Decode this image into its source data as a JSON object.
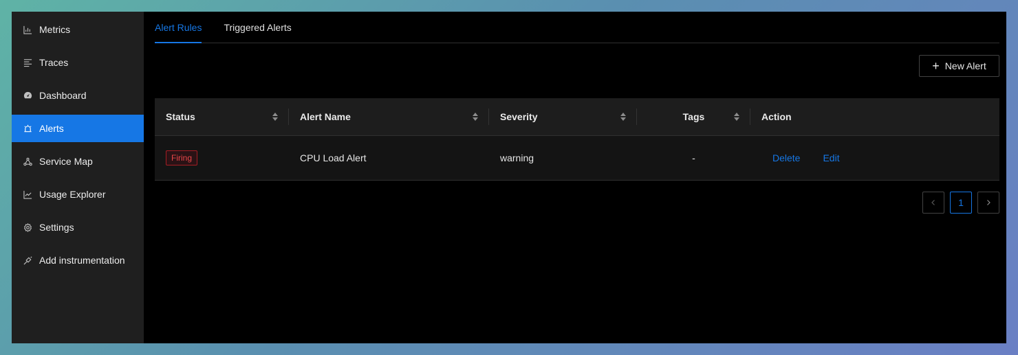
{
  "sidebar": {
    "items": [
      {
        "label": "Metrics",
        "icon": "bar-chart-icon"
      },
      {
        "label": "Traces",
        "icon": "list-icon"
      },
      {
        "label": "Dashboard",
        "icon": "dashboard-icon"
      },
      {
        "label": "Alerts",
        "icon": "alarm-icon",
        "active": true
      },
      {
        "label": "Service Map",
        "icon": "deployment-icon"
      },
      {
        "label": "Usage Explorer",
        "icon": "line-chart-icon"
      },
      {
        "label": "Settings",
        "icon": "gear-icon"
      },
      {
        "label": "Add instrumentation",
        "icon": "api-icon"
      }
    ]
  },
  "tabs": [
    {
      "label": "Alert Rules",
      "active": true
    },
    {
      "label": "Triggered Alerts",
      "active": false
    }
  ],
  "toolbar": {
    "new_alert_label": "New Alert"
  },
  "table": {
    "columns": [
      "Status",
      "Alert Name",
      "Severity",
      "Tags",
      "Action"
    ],
    "rows": [
      {
        "status": "Firing",
        "name": "CPU Load Alert",
        "severity": "warning",
        "tags": "-",
        "actions": [
          "Delete",
          "Edit"
        ]
      }
    ]
  },
  "pagination": {
    "current_page": "1",
    "prev": "<",
    "next": ">"
  },
  "colors": {
    "accent": "#1677e5",
    "firing": "#e84749",
    "sidebar_bg": "#1f1f1f",
    "content_bg": "#000000"
  }
}
